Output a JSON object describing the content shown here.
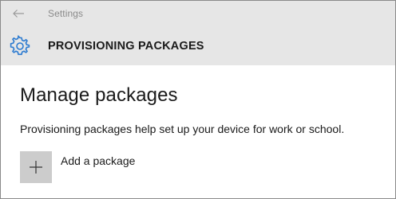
{
  "window": {
    "app_title": "Settings"
  },
  "header": {
    "title": "PROVISIONING PACKAGES",
    "icon": "gear-icon",
    "accent_color": "#2b7ad0"
  },
  "main": {
    "title": "Manage packages",
    "description": "Provisioning packages help set up your device for work or school.",
    "add_button": {
      "label": "Add a package",
      "icon": "plus-icon"
    }
  },
  "colors": {
    "titlebar_bg": "#e6e6e6",
    "content_bg": "#ffffff",
    "tile_bg": "#cccccc"
  }
}
